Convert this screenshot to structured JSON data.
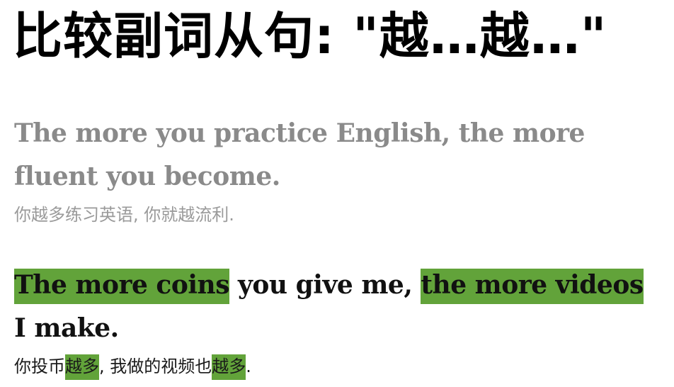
{
  "title": "比较副词从句: \"越…越…\"",
  "example1": {
    "en_line1": "The more you practice English, the more",
    "en_line2": "fluent you become.",
    "zh": "你越多练习英语, 你就越流利."
  },
  "example2": {
    "en_hl1": "The more coins",
    "en_mid": " you give me, ",
    "en_hl2": "the more videos",
    "en_line2": "I make.",
    "zh_part1": "你投币",
    "zh_hl1": "越多",
    "zh_part2": ", 我做的视频也",
    "zh_hl2": "越多",
    "zh_end": "."
  },
  "colors": {
    "highlight": "#62a33a",
    "muted_text": "#8a8a8a",
    "dark_text": "#111111"
  }
}
